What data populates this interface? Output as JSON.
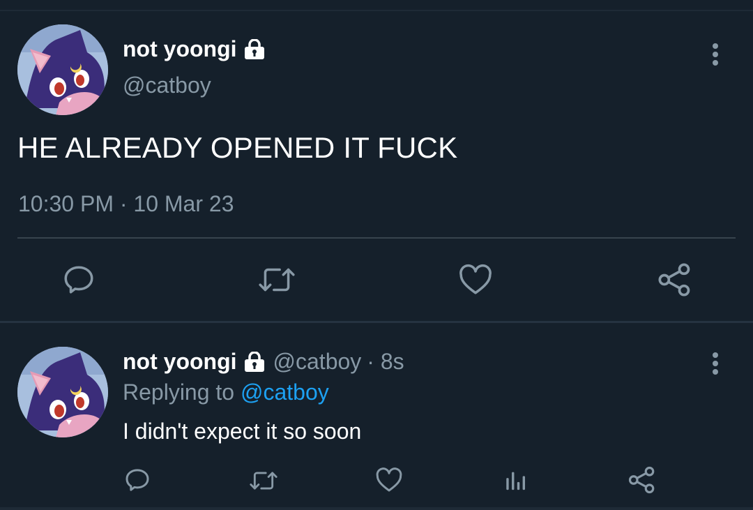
{
  "main_tweet": {
    "display_name": "not yoongi",
    "handle": "@catboy",
    "locked": true,
    "text": "HE ALREADY OPENED IT FUCK",
    "timestamp": "10:30 PM · 10 Mar 23",
    "avatar": "cat-avatar",
    "actions": [
      "reply-icon",
      "retweet-icon",
      "like-icon",
      "share-icon"
    ]
  },
  "reply_tweet": {
    "display_name": "not yoongi",
    "handle": "@catboy",
    "time": "· 8s",
    "replying_prefix": "Replying to",
    "replying_to": "@catboy",
    "text": "I didn't expect it so soon",
    "avatar": "cat-avatar",
    "actions": [
      "reply-icon",
      "retweet-icon",
      "like-icon",
      "analytics-icon",
      "share-icon"
    ]
  },
  "colors": {
    "background": "#15202b",
    "text_primary": "#ffffff",
    "text_secondary": "#8899a6",
    "accent": "#1da1f2",
    "separator": "#38444d"
  }
}
